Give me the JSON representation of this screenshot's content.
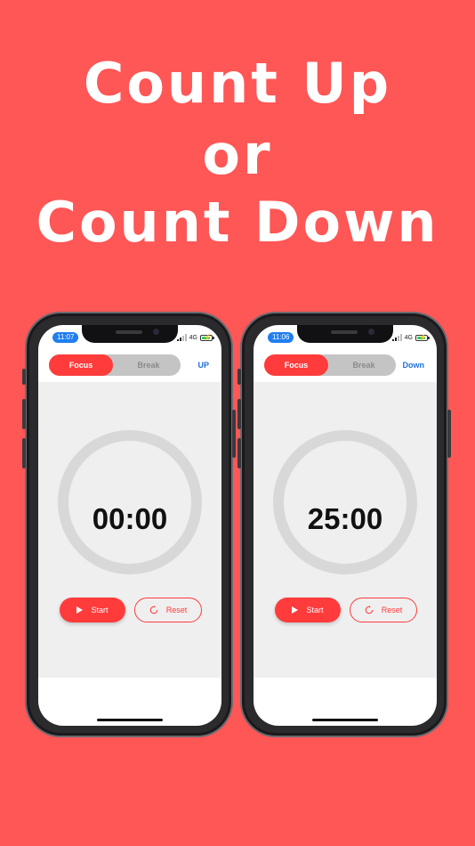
{
  "headline": {
    "line1": "Count Up",
    "line2": "or",
    "line3": "Count Down"
  },
  "colors": {
    "background": "#FF5656",
    "accent": "#FF3B3B",
    "mode_link": "#1F6FD6",
    "time_pill": "#1F7EF0"
  },
  "phones": [
    {
      "status": {
        "time": "11:07",
        "network": "4G"
      },
      "segment": {
        "focus_label": "Focus",
        "break_label": "Break",
        "selected": "Focus"
      },
      "mode_label": "UP",
      "timer": "00:00",
      "start_label": "Start",
      "reset_label": "Reset"
    },
    {
      "status": {
        "time": "11:06",
        "network": "4G"
      },
      "segment": {
        "focus_label": "Focus",
        "break_label": "Break",
        "selected": "Focus"
      },
      "mode_label": "Down",
      "timer": "25:00",
      "start_label": "Start",
      "reset_label": "Reset"
    }
  ]
}
